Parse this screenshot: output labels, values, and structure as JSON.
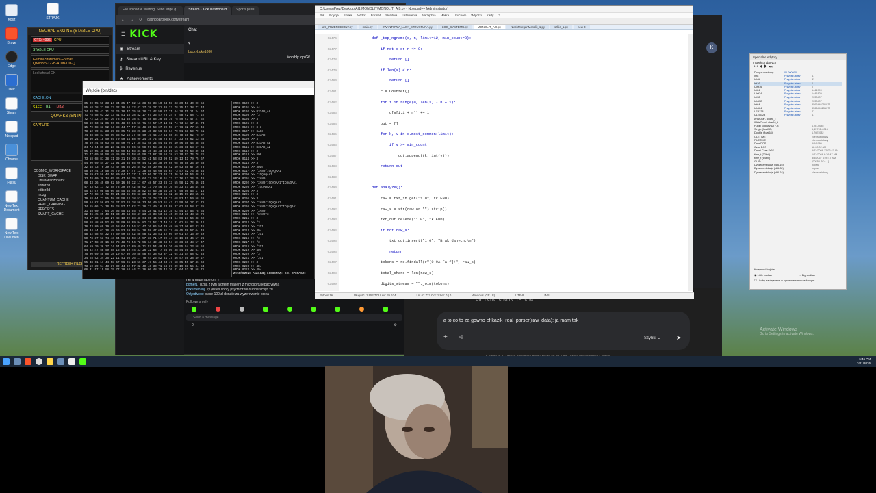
{
  "kick": {
    "tabs": [
      "File upload & sharing: Send large g...",
      "Stream - Kick Dashboard",
      "Sports pass"
    ],
    "url": "dashboard.kick.com/stream",
    "logo": "KICK",
    "sidebar": [
      {
        "label": "Stream",
        "icon": "signal-icon"
      },
      {
        "label": "Stream URL & Key",
        "icon": "key-icon"
      },
      {
        "label": "Revenue",
        "icon": "revenue-icon"
      },
      {
        "label": "Achievements",
        "icon": "trophy-icon"
      }
    ],
    "chat_title": "Chat",
    "top_gifter_title": "Monthly top Gif",
    "user": "LuckyLuke1080",
    "chat_lines": [
      {
        "user": "",
        "text": "hej w dupe raperom !!"
      },
      {
        "user": "pomer1:",
        "text": "jszda z tym alonem masem z microsoftu jebac vewla"
      },
      {
        "user": "pokemeoshj:",
        "text": "Ty jestes chory psychicznie dunderschyc xd"
      },
      {
        "user": "Odysdiwec:",
        "text": "place 100 zl donate za wyzerowanie pixea"
      }
    ],
    "followers_only": "Followers only",
    "send_placeholder": "Send a message",
    "chat_count": "0"
  },
  "neural": {
    "title": "NEURAL ENGINE (STABLE-CPU)",
    "ctx_label": "CTX: 4096",
    "cpu_label": "CPU",
    "stable_label": "STABLE CPU",
    "model": "Gemini-Statement-Format",
    "model2": "Qwen3.5-122B-A10B-UD-Q",
    "lookahead": "Lookahead OK",
    "cache": "CACHE:ON",
    "safe": "SAFE",
    "bal": "BAL",
    "max": "MAX",
    "quarks": "QUARKS (SNIPPET)",
    "capture": "CAPTURE",
    "workspace": "WORKSPACE",
    "tree": [
      "COSMIC_WORKSPACE",
      "DISK_SWAP",
      "Drill-Kwadzonator",
      "editor2d",
      "editor3d",
      "mdzg",
      "QUANTUM_CACHE",
      "REAL_TRAINING",
      "REPORTS",
      "SMART_CACHE"
    ],
    "refresh": "REFRESH FILES"
  },
  "terminal": {
    "title": "Wejście (bin/dec)",
    "footer": "ZAKOŃCZONO ANALIZĘ LOGICZNĄ: 231 OPERACJI",
    "hex_lines": [
      "65 00 55 50 33 24 84 35 47 62 13 38 58 38 10 64 58 33 39 43 40 00 58",
      "55 58 28 21 58 72 32 78 54 72 42 27 38 27 31 38 33 78 75 42 38 72 44",
      "24 88 15 43 31 39 26 78 37 25 58 38 73 42 58 27 31 44 38 75 11 24 67",
      "71 78 58 63 22 73 41 51 18 38 42 17 67 35 47 78 34 57 58 72 58 71 22",
      "72 72 32 24 07 36 78 41 58 78 57 75 48 58 20 58 79 75 40 73 47 27 62",
      "58 60 03 62 06 06 06 48 02 84 56 71 74 57 17 14 72 74 73 54 17 41 74",
      "15 79 08 63 52 74 88 44 77 57 63 48 30 58 67 29 58 67 76 82 77 16 48",
      "78 12 79 84 23 39 98 65 78 38 26 28 45 32 56 38 64 79 51 68 59 79 51",
      "74 38 58 43 45 56 65 62 18 17 58 49 75 44 27 44 58 34 78 28 62 75 67",
      "48 60 24 18 99 99 79 99 44 88 99 24 78 74 48 75 84 27 33 78 62 13 68",
      "78 69 44 58 63 48 66 50 70 27 35 51 48 34 54 84 56 40 46 68 44 38 55",
      "34 74 64 80 29 23 41 81 98 66 58 58 57 58 48 25 88 55 36 81 58 67 65",
      "55 52 55 40 68 55 58 59 44 58 31 18 45 48 43 53 89 16 73 78 58 39 54",
      "71 47 09 99 58 48 45 06 78 58 65 58 71 67 39 58 38 53 70 33 74 78 21",
      "73 58 68 81 38 71 39 31 49 30 33 52 41 53 83 99 52 89 13 41 79 75 67",
      "54 00 69 44 27 12 94 25 38 65 06 44 42 36 38 99 98 08 79 38 34 49 33",
      "32 58 73 70 39 43 47 46 35 26 44 62 58 39 06 34 42 40 93 38 67 16 78",
      "58 49 44 16 50 46 79 39 27 47 13 38 58 48 60 56 64 73 57 52 73 38 45",
      "78 69 63 58 44 50 80 64 47 27 15 77 66 37 23 38 31 36 74 30 56 48 18",
      "33 78 60 36 74 05 46 47 30 15 25 64 27 13 16 61 12 27 16 12 24 25 48",
      "68 43 36 49 69 62 50 16 03 12 17 67 48 57 33 28 13 55 58 12 74 46 24",
      "47 53 62 17 72 58 73 39 59 42 58 62 73 79 46 82 16 55 33 27 34 44 58",
      "55 52 57 08 58 06 58 55 58 48 38 82 54 63 38 68 38 67 99 36 53 17 15",
      "17 72 68 15 78 55 24 33 85 59 63 20 58 37 53 51 12 48 15 37 28 55 25",
      "79 68 64 73 55 58 43 58 24 38 53 72 39 78 27 83 13 68 53 43 50 58 68",
      "50 64 82 58 63 29 27 52 28 38 56 73 50 49 53 51 43 43 59 60 17 42 76",
      "74 15 06 74 30 58 28 57 47 62 73 38 23 49 16 24 98 37 62 26 58 37 35",
      "31 58 60 77 64 30 06 55 44 55 75 54 28 41 51 12 15 52 54 14 54 78 66",
      "62 36 45 05 48 51 83 49 64 68 47 23 48 38 53 56 46 39 04 50 48 58 78",
      "74 17 30 13 23 27 48 13 39 88 48 64 65 44 56 66 71 64 56 17 56 38 62",
      "58 68 48 60 52 68 33 99 98 99 94 82 37 52 17 40 34 31 61 84 72 36 12",
      "78 73 80 69 39 49 58 64 43 54 57 47 36 66 54 70 48 50 27 50 62 33 46",
      "66 34 44 67 30 48 50 53 69 58 54 38 58 47 65 51 17 60 45 38 57 64 48",
      "48 42 58 64 32 57 60 59 28 52 88 58 52 33 51 42 60 59 61 44 16 39 49",
      "50 78 37 53 74 43 64 58 34 58 15 57 38 71 17 29 44 58 16 26 46 17 28",
      "71 17 58 30 16 63 78 48 78 54 72 56 14 49 48 68 54 60 36 50 48 17 47",
      "64 59 39 36 17 34 64 63 17 69 49 11 57 54 40 46 26 60 55 64 23 58 58",
      "44 82 47 58 59 58 15 56 49 44 33 26 32 68 77 56 50 38 44 26 32 51 22",
      "75 00 69 48 86 38 19 67 30 70 88 58 64 38 63 37 12 64 31 54 58 62 48",
      "34 28 52 34 35 22 11 41 56 36 17 70 44 25 52 21 17 46 57 69 38 49 27",
      "55 48 61 17 44 58 57 56 25 23 56 37 47 55 44 63 47 68 65 45 17 46 60",
      "73 50 39 54 43 37 39 44 22 57 32 40 46 33 71 58 37 39 19 33 55 34 54",
      "66 31 57 15 58 25 77 28 54 44 73 36 60 48 35 42 70 41 64 62 31 58 71"
    ],
    "log_lines": [
      "KROK 0100 >> 3",
      "KROK 0101 >> A4",
      "KROK 0102 >> B31A8_A8",
      "KROK 0103 >> \"3",
      "KROK 0104 >> 3",
      "KROK 0105 >> 3",
      "KROK 0106 >> 8.3",
      "KROK 0107 >> 8A03",
      "KROK 0108 >> B31A8",
      "KROK 0109 >> 3",
      "KROK 0110 >> B31A8_AE",
      "KROK 0111 >> B31A8_A2",
      "KROK 0112 >> 3",
      "KROK 0113 >> 8D0",
      "KROK 0114 >> 3",
      "KROK 0115 >> 3",
      "KROK 0116 >> 3DD0",
      "KROK 0117 >> \"2A89\"ICQAQAA1",
      "KROK 0200 >> \"ICQAQAA1",
      "KROK 0201 >> \"2A89",
      "KROK 0202 >> \"2A89\"ICQAQAA1\"ICQAQAA1",
      "KROK 0203 >> \"ICQAQAA1",
      "KROK 0204 >> 3",
      "KROK 0205 >> 3",
      "KROK 0206 >> 3",
      "KROK 0207 >> \"2A89\"ICQAQAA1",
      "KROK 0208 >> \"2A89\"ICQAQAA1\"ICQAQAA1",
      "KROK 0209 >> \"2A89T",
      "KROK 0210 >> \"2A89T3",
      "KROK 0211 >> 3",
      "KROK 0212 >> \"3",
      "KROK 0213 >> \"2C1",
      "KROK 0214 >> 4D/",
      "KROK 0215 >> \"2C1",
      "KROK 0216 >> \"3",
      "KROK 0217 >> \"3",
      "KROK 0218 >> \"2C1",
      "KROK 0219 >> 4D/",
      "KROK 0220 >> \"3",
      "KROK 0221 >> \"2C1",
      "KROK 0222 >> 3",
      "KROK 0223 >> 4D/",
      "KROK 0224 >> 4D/"
    ]
  },
  "editor": {
    "title": "C:\\Users\\Prez\\Desktop\\AI1 MONOLIT\\MONOLIT_AI9.py - Notepad++ [Administrator]",
    "menu": [
      "Plik",
      "Edycja",
      "Szukaj",
      "Widok",
      "Format",
      "Składnia",
      "Ustawienia",
      "Narzędzia",
      "Makra",
      "Uruchom",
      "Wtyczki",
      "Karty",
      "?"
    ],
    "tabs": [
      "ai9_PRZEROBIONY.py",
      "main.py",
      "KWANTOWY_LAKA_STRUKTURA.py",
      "LOG_SYSTEMU.py",
      "MONOLIT_AI9.py",
      "NiechMorganMonolit_1.py",
      "szkic_1.py",
      "new 3"
    ],
    "active_tab_index": 4,
    "line_numbers": [
      "62476",
      "62477",
      "62478",
      "62479",
      "62480",
      "62481",
      "62482",
      "62483",
      "62484",
      "62485",
      "62486",
      "62487",
      "62488",
      "62489",
      "62490",
      "62491",
      "62492",
      "62493",
      "62494",
      "62495",
      "62496",
      "62497",
      "62498",
      "62499"
    ],
    "code_lines": [
      "def _top_ngrams(s, n, limit=12, min_count=3):",
      "    if not s or n <= 0:",
      "        return []",
      "    if len(s) < n:",
      "        return []",
      "    c = Counter()",
      "    for i in range(0, len(s) - n + 1):",
      "        c[s[i:i + n]] += 1",
      "    out = []",
      "    for k, v in c.most_common(limit):",
      "        if v >= min_count:",
      "            out.append((k, int(v)))",
      "    return out",
      "",
      "def analyze():",
      "    raw = txt_in.get(\"1.0\", tk.END)",
      "    raw_s = str(raw or \"\").strip()",
      "    txt_out.delete(\"1.0\", tk.END)",
      "    if not raw_s:",
      "        txt_out.insert(\"1.0\", \"Brak danych.\\n\")",
      "        return",
      "    tokens = re.findall(r\"[0-9A-Fa-f]+\", raw_s)",
      "    total_chars = len(raw_s)",
      "    digits_stream = \"\".join(tokens)"
    ],
    "status": [
      "Python file",
      "Długość: 1 952 778   Linii: 35 624",
      "Ln: 62 723   Col: 1   Sel: 0 | 0",
      "Windows (CR LF)",
      "UTF-8",
      "INS"
    ]
  },
  "gemini": {
    "overlay_code": "current_chunk += char",
    "input_text": "a to co to za gowno ef kazik_real_parser(raw_data): ja mam tak",
    "mode_label": "Szybki",
    "disclaimer": "Gemini to AI i może popełniać błędy, także co do ludzi. Twoja prywatność i Gemini"
  },
  "props": {
    "title": "Specjalne edytory",
    "section": "Inspektor danych",
    "rows": [
      {
        "k": "Dołącz do strony",
        "v": "01 000000",
        "d": ""
      },
      {
        "k": "Int8",
        "v": "Przypis ustaw",
        "d": "47"
      },
      {
        "k": "UInt8",
        "v": "Przypis ustaw",
        "d": "47"
      },
      {
        "k": "Int16",
        "v": "Przypis ustaw",
        "d": "0"
      },
      {
        "k": "UInt16",
        "v": "Przypis ustaw",
        "d": "0"
      },
      {
        "k": "Int24",
        "v": "Przypis ustaw",
        "d": "1441999"
      },
      {
        "k": "UInt24",
        "v": "Przypis ustaw",
        "d": "1441829"
      },
      {
        "k": "Int32",
        "v": "Przypis ustaw",
        "d": "2030407"
      },
      {
        "k": "UInt32",
        "v": "Przypis ustaw",
        "d": "2030407"
      },
      {
        "k": "Int64",
        "v": "Przypis ustaw",
        "d": "3566446251073"
      },
      {
        "k": "UInt64",
        "v": "Przypis ustaw",
        "d": "3566446251073"
      },
      {
        "k": "LEB128",
        "v": "Przypis ustaw",
        "d": "47"
      },
      {
        "k": "ULEB128",
        "v": "Przypis ustaw",
        "d": "47"
      },
      {
        "k": "AnsiChar / char8_t",
        "v": "",
        "d": ""
      },
      {
        "k": "WideChar / char16_t",
        "v": "",
        "d": ""
      },
      {
        "k": "Punkt kodowy UTF-8",
        "v": "",
        "d": "1,2E-0035"
      },
      {
        "k": "Single (float32)",
        "v": "",
        "d": "5,4579E-0316"
      },
      {
        "k": "Double (float64)",
        "v": "",
        "d": "1,76E-032"
      },
      {
        "k": "OLETIME",
        "v": "",
        "d": "Nieprawidłowy"
      },
      {
        "k": "FILETIME",
        "v": "",
        "d": "Nieprawidłowy"
      },
      {
        "k": "Data DOS",
        "v": "",
        "d": "5/6/1980"
      },
      {
        "k": "Czas DOS",
        "v": "",
        "d": "12:00:02 AM"
      },
      {
        "k": "Data i Czas DOS",
        "v": "",
        "d": "5/22/2008 12:02:47 AM"
      },
      {
        "k": "time_t (32 bit)",
        "v": "",
        "d": "1/23/2066 6:26:47 AM"
      },
      {
        "k": "time_t (64 bit)",
        "v": "",
        "d": "3/5/2067 6:26:47 AM"
      },
      {
        "k": "GUID",
        "v": "",
        "d": "{00F56-7CA...}"
      },
      {
        "k": "Dyssasemblacja (x86-16)",
        "v": "",
        "d": "popaw"
      },
      {
        "k": "Dyssasemblacja (x86-32)",
        "v": "",
        "d": "popad"
      },
      {
        "k": "Dyssasemblacja (x86-64)",
        "v": "",
        "d": "Nieprawidłowy"
      }
    ],
    "byte_order": "Kolejność bajtów",
    "little_endian": "Little endian",
    "big_endian": "Big endian",
    "hex_check": "Liczby zapisywane w systemie szesnastkowym"
  },
  "desktop": {
    "icons": [
      "Kosz",
      "Brave",
      "Edge",
      "Dev",
      "Steam",
      "Notepad",
      "Chrome",
      "Fujisu",
      "Gem",
      "Do",
      "New Text Document",
      "New Text Documen",
      "STRAJK"
    ],
    "activate": "Activate Windows",
    "activate_sub": "Go to Settings to activate Windows.",
    "clock_time": "6:46 PM",
    "clock_date": "3/21/2026"
  },
  "colors": {
    "kick_green": "#53fc18",
    "editor_bg": "#ffffff",
    "gemini_bg": "#1f1f1f"
  }
}
